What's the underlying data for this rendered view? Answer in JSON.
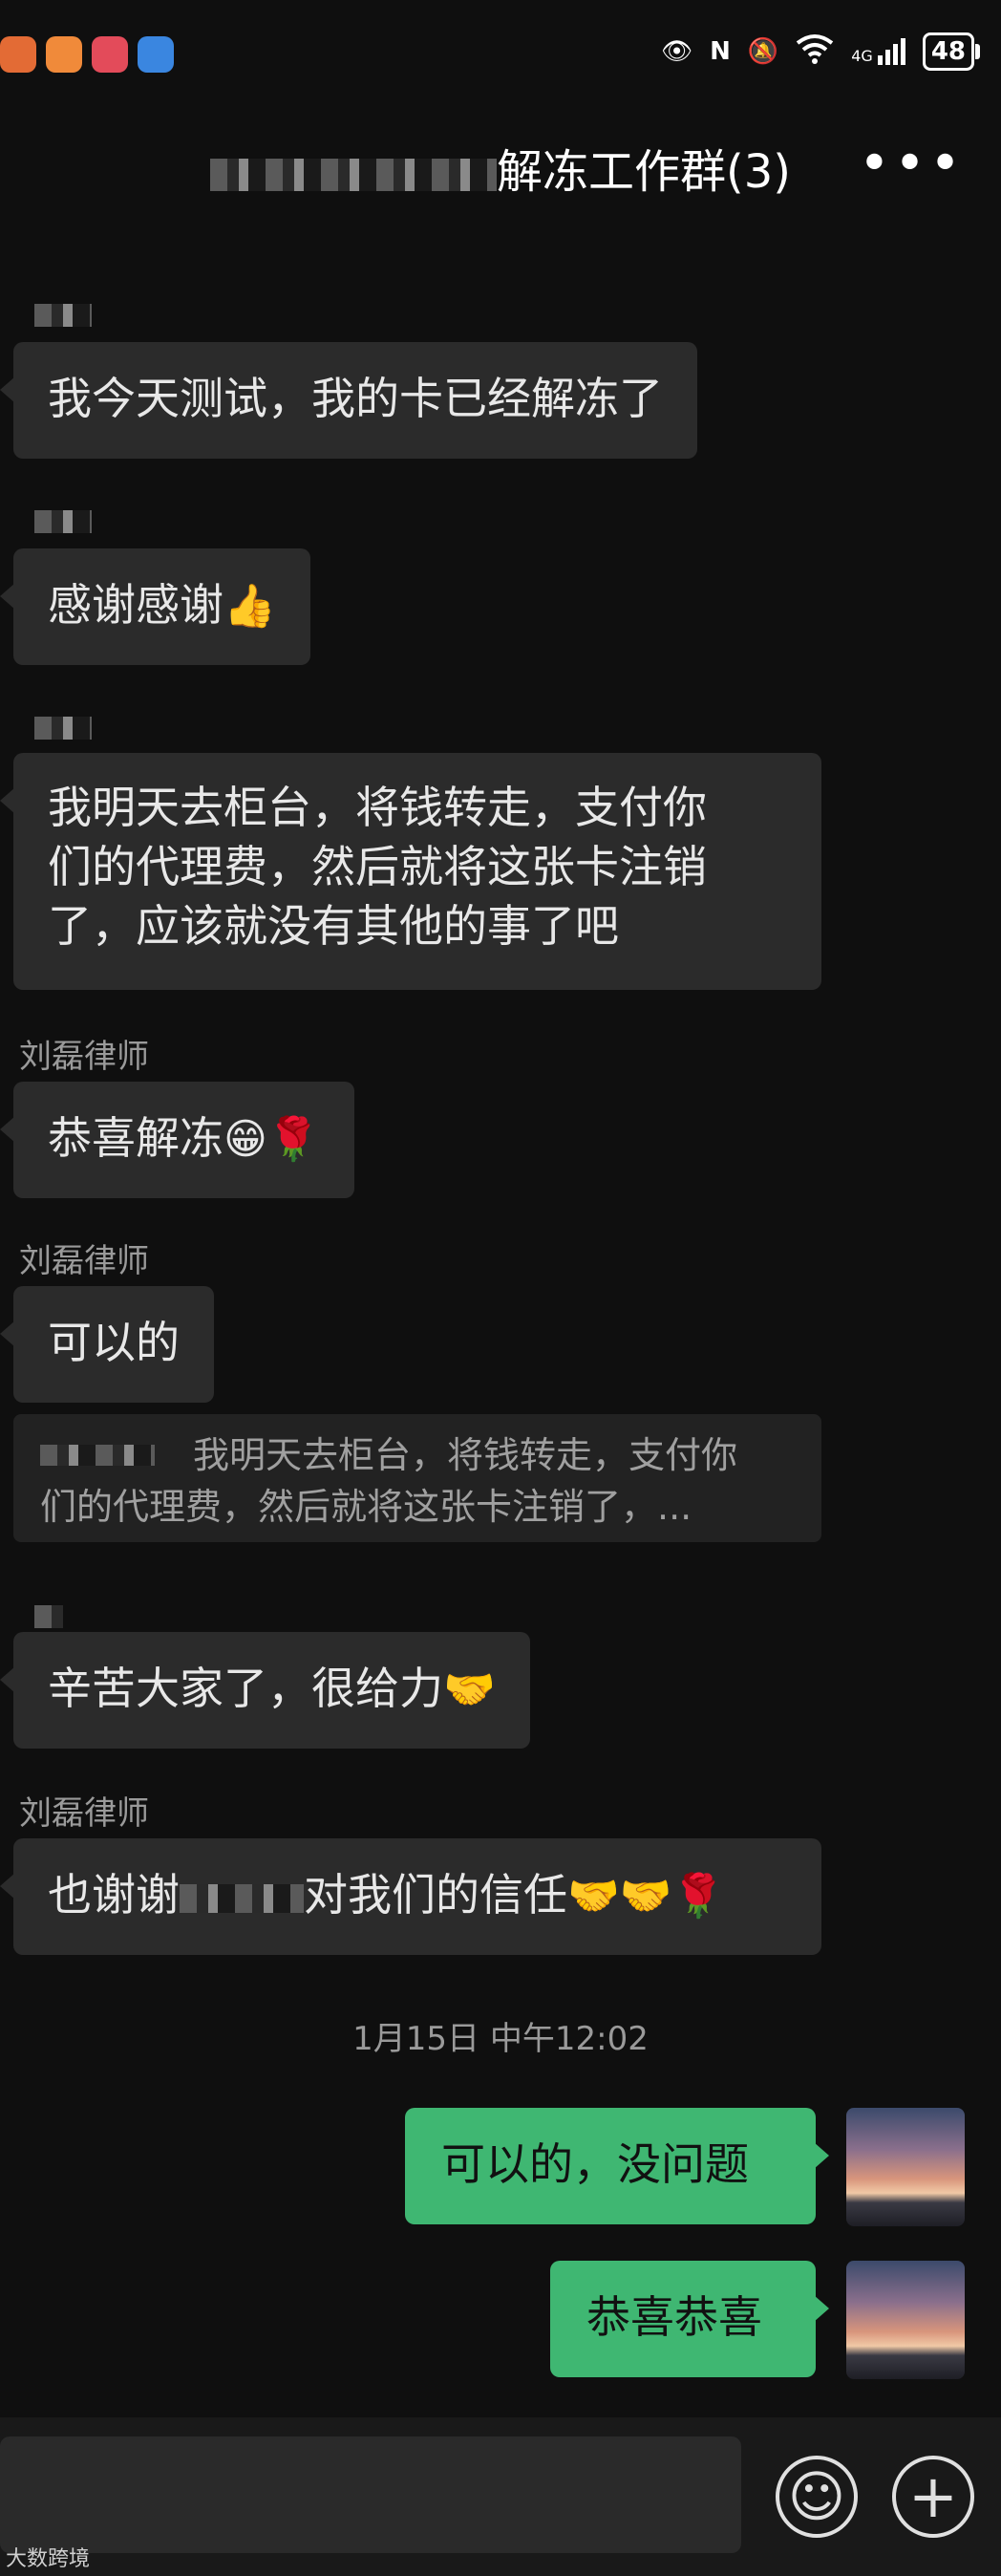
{
  "status_bar": {
    "battery": "48",
    "network": "4G",
    "left_app_colors": [
      "#e36b35",
      "#f08a3a",
      "#e34b5a",
      "#3a86e0"
    ]
  },
  "header": {
    "title_visible": "解冻工作群(3)",
    "more_label": "•••"
  },
  "messages": [
    {
      "text": "我今天测试，我的卡已经解冻了"
    },
    {
      "text": "感谢感谢",
      "emoji": "👍"
    },
    {
      "lines": [
        "我明天去柜台，将钱转走，支付你",
        "们的代理费，然后就将这张卡注销",
        "了，应该就没有其他的事了吧"
      ]
    },
    {
      "sender": "刘磊律师",
      "text": "恭喜解冻",
      "emoji": "😁🌹"
    },
    {
      "sender": "刘磊律师",
      "text": "可以的",
      "quote_lines": [
        "我明天去柜台，将钱转走，支付你",
        "们的代理费，然后就将这张卡注销了，..."
      ]
    },
    {
      "text": "辛苦大家了，很给力",
      "emoji": "🤝"
    },
    {
      "sender": "刘磊律师",
      "text_a": "也谢谢",
      "text_b": "对我们的信任",
      "emoji": "🤝🤝🌹"
    }
  ],
  "timestamp": "1月15日 中午12:02",
  "outgoing": [
    {
      "text": "可以的，没问题"
    },
    {
      "text": "恭喜恭喜"
    }
  ],
  "bottom": {
    "emoji_btn": "☺",
    "plus_btn": "+",
    "watermark": "大数跨境"
  },
  "colors": {
    "background": "#0f0f0f",
    "incoming_bubble": "#2b2b2b",
    "outgoing_bubble": "#3fb772"
  }
}
